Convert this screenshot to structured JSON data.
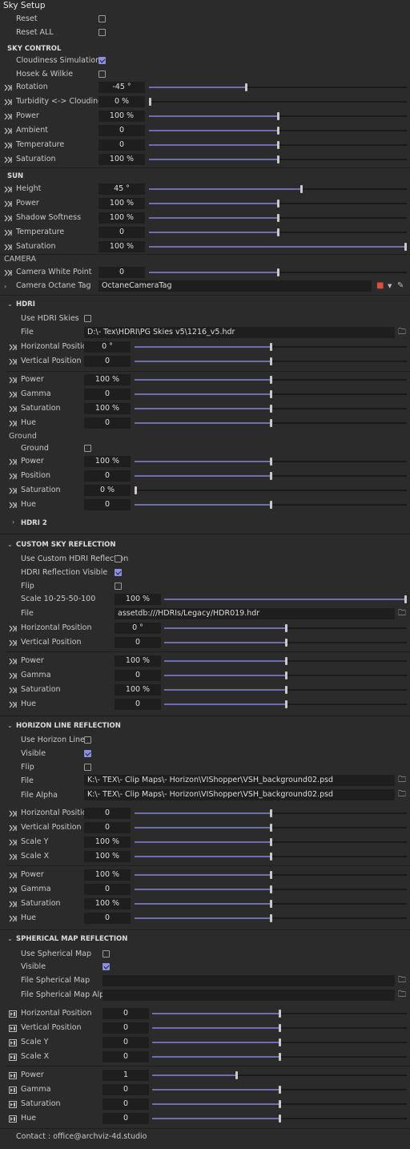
{
  "title": "Sky Setup",
  "top": {
    "reset": "Reset",
    "reset_all": "Reset ALL"
  },
  "sky_control": {
    "header": "SKY CONTROL",
    "cloudiness_sim": "Cloudiness Simulation",
    "hosek": "Hosek & Wilkie",
    "rows": [
      {
        "label": "Rotation",
        "value": "-45 °",
        "level": 0.375
      },
      {
        "label": "Turbidity <-> Cloudiness",
        "value": "0 %",
        "level": 0.0
      },
      {
        "label": "Power",
        "value": "100 %",
        "level": 0.5
      },
      {
        "label": "Ambient",
        "value": "0",
        "level": 0.5
      },
      {
        "label": "Temperature",
        "value": "0",
        "level": 0.5
      },
      {
        "label": "Saturation",
        "value": "100 %",
        "level": 0.5
      }
    ]
  },
  "sun": {
    "header": "SUN",
    "rows": [
      {
        "label": "Height",
        "value": "45 °",
        "level": 0.59
      },
      {
        "label": "Power",
        "value": "100 %",
        "level": 0.5
      },
      {
        "label": "Shadow Softness",
        "value": "100 %",
        "level": 0.5
      },
      {
        "label": "Temperature",
        "value": "0",
        "level": 0.5
      },
      {
        "label": "Saturation",
        "value": "100 %",
        "level": 1.0
      }
    ]
  },
  "camera": {
    "header": "CAMERA",
    "white_point": {
      "label": "Camera White Point",
      "value": "0",
      "level": 0.5
    },
    "tag_label": "Camera Octane Tag",
    "tag_value": "OctaneCameraTag"
  },
  "hdri": {
    "header": "HDRI",
    "use": "Use HDRI Skies",
    "file_label": "File",
    "file_value": "D:\\- Tex\\HDRI\\PG Skies v5\\1216_v5.hdr",
    "rows_a": [
      {
        "label": "Horizontal Position",
        "value": "0 °",
        "level": 0.5
      },
      {
        "label": "Vertical Position",
        "value": "0",
        "level": 0.5
      }
    ],
    "rows_b": [
      {
        "label": "Power",
        "value": "100 %",
        "level": 0.5
      },
      {
        "label": "Gamma",
        "value": "0",
        "level": 0.5
      },
      {
        "label": "Saturation",
        "value": "100 %",
        "level": 0.5
      },
      {
        "label": "Hue",
        "value": "0",
        "level": 0.5
      }
    ],
    "ground_header": "Ground",
    "ground": "Ground",
    "rows_c": [
      {
        "label": "Power",
        "value": "100 %",
        "level": 0.5
      },
      {
        "label": "Position",
        "value": "0",
        "level": 0.5
      },
      {
        "label": "Saturation",
        "value": "0 %",
        "level": 0.0
      },
      {
        "label": "Hue",
        "value": "0",
        "level": 0.5
      }
    ],
    "hdri2": "HDRI 2"
  },
  "csr": {
    "header": "CUSTOM SKY REFLECTION",
    "use_custom": "Use Custom HDRI Reflection",
    "visible": "HDRI Reflection Visible",
    "flip": "Flip",
    "scale": {
      "label": "Scale 10-25-50-100",
      "value": "100 %",
      "level": 1.0
    },
    "file_label": "File",
    "file_value": "assetdb:///HDRIs/Legacy/HDR019.hdr",
    "rows_a": [
      {
        "label": "Horizontal Position",
        "value": "0 °",
        "level": 0.5
      },
      {
        "label": "Vertical Position",
        "value": "0",
        "level": 0.5
      }
    ],
    "rows_b": [
      {
        "label": "Power",
        "value": "100 %",
        "level": 0.5
      },
      {
        "label": "Gamma",
        "value": "0",
        "level": 0.5
      },
      {
        "label": "Saturation",
        "value": "100 %",
        "level": 0.5
      },
      {
        "label": "Hue",
        "value": "0",
        "level": 0.5
      }
    ]
  },
  "hlr": {
    "header": "HORIZON LINE REFLECTION",
    "use": "Use Horizon Line",
    "visible": "Visible",
    "flip": "Flip",
    "file_label": "File",
    "file_value": "K:\\- TEX\\- Clip Maps\\- Horizon\\VIShopper\\VSH_background02.psd",
    "alpha_label": "File Alpha",
    "alpha_value": "K:\\- TEX\\- Clip Maps\\- Horizon\\VIShopper\\VSH_background02.psd",
    "rows_a": [
      {
        "label": "Horizontal Position",
        "value": "0",
        "level": 0.5
      },
      {
        "label": "Vertical Position",
        "value": "0",
        "level": 0.5
      },
      {
        "label": "Scale Y",
        "value": "100 %",
        "level": 0.5
      },
      {
        "label": "Scale X",
        "value": "100 %",
        "level": 0.5
      }
    ],
    "rows_b": [
      {
        "label": "Power",
        "value": "100 %",
        "level": 0.5
      },
      {
        "label": "Gamma",
        "value": "0",
        "level": 0.5
      },
      {
        "label": "Saturation",
        "value": "100 %",
        "level": 0.5
      },
      {
        "label": "Hue",
        "value": "0",
        "level": 0.5
      }
    ]
  },
  "smr": {
    "header": "SPHERICAL MAP REFLECTION",
    "use": "Use Spherical Map",
    "visible": "Visible",
    "file_label": "File Spherical Map",
    "alpha_label": "File Spherical Map Alpha",
    "rows_a": [
      {
        "label": "Horizontal Position",
        "value": "0",
        "level": 0.5
      },
      {
        "label": "Vertical Position",
        "value": "0",
        "level": 0.5
      },
      {
        "label": "Scale Y",
        "value": "0",
        "level": 0.5
      },
      {
        "label": "Scale X",
        "value": "0",
        "level": 0.5
      }
    ],
    "rows_b": [
      {
        "label": "Power",
        "value": "1",
        "level": 0.33
      },
      {
        "label": "Gamma",
        "value": "0",
        "level": 0.5
      },
      {
        "label": "Saturation",
        "value": "0",
        "level": 0.5
      },
      {
        "label": "Hue",
        "value": "0",
        "level": 0.5
      }
    ]
  },
  "contact": "Contact : office@archviz-4d.studio",
  "colors": {
    "accent": "#6b6fb2",
    "checkbox_on": "#8a8fe0",
    "bg": "#2b2b2b",
    "field": "#1e1e1e"
  }
}
